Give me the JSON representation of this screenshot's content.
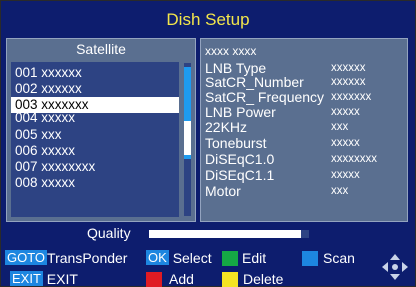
{
  "title": "Dish Setup",
  "satellite_panel": {
    "header": "Satellite",
    "items": [
      "001 xxxxxx",
      "002 xxxxxx",
      "003 xxxxxxx",
      "004 xxxxx",
      "005 xxx",
      "006 xxxxx",
      "007 xxxxxxxx",
      "008 xxxxx"
    ],
    "selected_index": 2
  },
  "info_panel": {
    "header": "xxxx  xxxx",
    "rows": [
      {
        "label": "LNB Type",
        "value": "xxxxxx"
      },
      {
        "label": "SatCR_Number",
        "value": "xxxxxx"
      },
      {
        "label": "SatCR_ Frequency",
        "value": "xxxxxxx"
      },
      {
        "label": "LNB Power",
        "value": "xxxxx"
      },
      {
        "label": "22KHz",
        "value": "xxx"
      },
      {
        "label": "Toneburst",
        "value": "xxxxx"
      },
      {
        "label": "DiSEqC1.0",
        "value": "xxxxxxxx"
      },
      {
        "label": "DiSEqC1.1",
        "value": "xxxxx"
      },
      {
        "label": "Motor",
        "value": "xxx"
      }
    ]
  },
  "quality": {
    "label": "Quality",
    "level_percent": 95
  },
  "help": {
    "goto_key": "GOTO",
    "goto_label": "TransPonder",
    "ok_key": "OK",
    "ok_label": "Select",
    "exit_key": "EXIT",
    "exit_label": "EXIT",
    "edit_label": "Edit",
    "scan_label": "Scan",
    "add_label": "Add",
    "delete_label": "Delete"
  },
  "colors": {
    "background": "#0d1d6e",
    "title": "#f3e64b",
    "panel": "#5a6f90",
    "key_blue": "#1d86e0",
    "green": "#15a845",
    "blue": "#1d86e0",
    "red": "#e01b23",
    "yellow": "#f5e423"
  }
}
